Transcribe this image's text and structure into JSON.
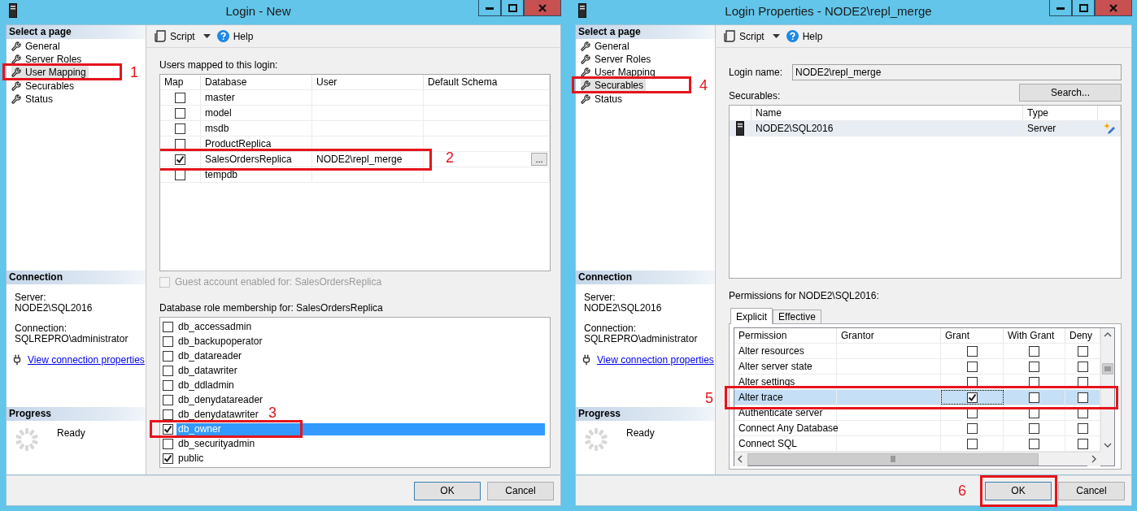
{
  "windows": [
    {
      "kind": "user_mapping",
      "title": "Login - New",
      "sidebar": {
        "heading": "Select a page",
        "pages": [
          {
            "label": "General",
            "selected": false
          },
          {
            "label": "Server Roles",
            "selected": false
          },
          {
            "label": "User Mapping",
            "selected": true,
            "annotation": "1"
          },
          {
            "label": "Securables",
            "selected": false
          },
          {
            "label": "Status",
            "selected": false
          }
        ]
      },
      "connection": {
        "heading": "Connection",
        "server_label": "Server:",
        "server": "NODE2\\SQL2016",
        "connection_label": "Connection:",
        "connection": "SQLREPRO\\administrator",
        "link": "View connection properties"
      },
      "progress": {
        "heading": "Progress",
        "status": "Ready"
      },
      "toolbar": {
        "script": "Script",
        "help": "Help"
      },
      "mapping": {
        "label": "Users mapped to this login:",
        "columns": [
          "Map",
          "Database",
          "User",
          "Default Schema"
        ],
        "rows": [
          {
            "map": false,
            "database": "master"
          },
          {
            "map": false,
            "database": "model"
          },
          {
            "map": false,
            "database": "msdb"
          },
          {
            "map": false,
            "database": "ProductReplica"
          },
          {
            "map": true,
            "database": "SalesOrdersReplica",
            "user": "NODE2\\repl_merge",
            "browse": "...",
            "annotation": "2"
          },
          {
            "map": false,
            "database": "tempdb"
          }
        ]
      },
      "guest": {
        "label": "Guest account enabled for: SalesOrdersReplica",
        "checked": false,
        "disabled": true
      },
      "roles": {
        "label": "Database role membership for: SalesOrdersReplica",
        "items": [
          {
            "name": "db_accessadmin",
            "checked": false,
            "selected": false
          },
          {
            "name": "db_backupoperator",
            "checked": false,
            "selected": false
          },
          {
            "name": "db_datareader",
            "checked": false,
            "selected": false
          },
          {
            "name": "db_datawriter",
            "checked": false,
            "selected": false
          },
          {
            "name": "db_ddladmin",
            "checked": false,
            "selected": false
          },
          {
            "name": "db_denydatareader",
            "checked": false,
            "selected": false
          },
          {
            "name": "db_denydatawriter",
            "checked": false,
            "selected": false
          },
          {
            "name": "db_owner",
            "checked": true,
            "selected": true,
            "annotation": "3"
          },
          {
            "name": "db_securityadmin",
            "checked": false,
            "selected": false
          },
          {
            "name": "public",
            "checked": true,
            "selected": false
          }
        ]
      },
      "buttons": [
        {
          "label": "OK",
          "default": true
        },
        {
          "label": "Cancel",
          "default": false
        }
      ]
    },
    {
      "kind": "securables",
      "title": "Login Properties - NODE2\\repl_merge",
      "sidebar": {
        "heading": "Select a page",
        "pages": [
          {
            "label": "General",
            "selected": false
          },
          {
            "label": "Server Roles",
            "selected": false
          },
          {
            "label": "User Mapping",
            "selected": false
          },
          {
            "label": "Securables",
            "selected": true,
            "annotation": "4"
          },
          {
            "label": "Status",
            "selected": false
          }
        ]
      },
      "connection": {
        "heading": "Connection",
        "server_label": "Server:",
        "server": "NODE2\\SQL2016",
        "connection_label": "Connection:",
        "connection": "SQLREPRO\\administrator",
        "link": "View connection properties"
      },
      "progress": {
        "heading": "Progress",
        "status": "Ready"
      },
      "toolbar": {
        "script": "Script",
        "help": "Help"
      },
      "login": {
        "label": "Login name:",
        "value": "NODE2\\repl_merge"
      },
      "securables": {
        "label": "Securables:",
        "search": "Search...",
        "columns": [
          "Name",
          "Type"
        ],
        "rows": [
          {
            "name": "NODE2\\SQL2016",
            "type": "Server"
          }
        ]
      },
      "permissions": {
        "label": "Permissions for NODE2\\SQL2016:",
        "tabs": [
          {
            "label": "Explicit",
            "selected": true
          },
          {
            "label": "Effective",
            "selected": false
          }
        ],
        "columns": [
          "Permission",
          "Grantor",
          "Grant",
          "With Grant",
          "Deny"
        ],
        "rows": [
          {
            "permission": "Alter resources",
            "grant": false,
            "with_grant": false,
            "deny": false,
            "selected": false
          },
          {
            "permission": "Alter server state",
            "grant": false,
            "with_grant": false,
            "deny": false,
            "selected": false
          },
          {
            "permission": "Alter settings",
            "grant": false,
            "with_grant": false,
            "deny": false,
            "selected": false
          },
          {
            "permission": "Alter trace",
            "grant": true,
            "with_grant": false,
            "deny": false,
            "selected": true,
            "annotation": "5"
          },
          {
            "permission": "Authenticate server",
            "grant": false,
            "with_grant": false,
            "deny": false,
            "selected": false
          },
          {
            "permission": "Connect Any Database",
            "grant": false,
            "with_grant": false,
            "deny": false,
            "selected": false
          },
          {
            "permission": "Connect SQL",
            "grant": false,
            "with_grant": false,
            "deny": false,
            "selected": false
          }
        ]
      },
      "buttons": [
        {
          "label": "OK",
          "default": true,
          "annotation": "6"
        },
        {
          "label": "Cancel",
          "default": false
        }
      ]
    }
  ]
}
